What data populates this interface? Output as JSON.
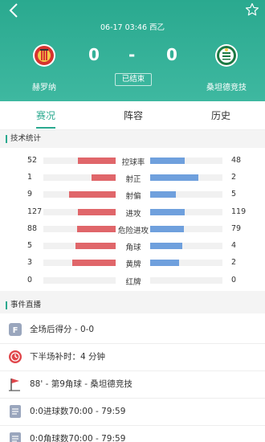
{
  "header": {
    "datetime": "06-17 03:46 西乙",
    "home_team": "赫罗纳",
    "away_team": "桑坦德竞技",
    "home_score": "0",
    "separator": "-",
    "away_score": "0",
    "status": "已结束",
    "icons": {
      "back": "chevron-left-icon",
      "favorite": "star-outline-icon"
    }
  },
  "tabs": [
    "赛况",
    "阵容",
    "历史"
  ],
  "active_tab": "赛况",
  "stats_section": {
    "title": "技术统计",
    "rows": [
      {
        "label": "控球率",
        "home": "52",
        "away": "48",
        "home_fill": 0.52,
        "away_fill": 0.48
      },
      {
        "label": "射正",
        "home": "1",
        "away": "2",
        "home_fill": 0.33,
        "away_fill": 0.67
      },
      {
        "label": "射偏",
        "home": "9",
        "away": "5",
        "home_fill": 0.64,
        "away_fill": 0.36
      },
      {
        "label": "进攻",
        "home": "127",
        "away": "119",
        "home_fill": 0.52,
        "away_fill": 0.48
      },
      {
        "label": "危险进攻",
        "home": "88",
        "away": "79",
        "home_fill": 0.53,
        "away_fill": 0.47
      },
      {
        "label": "角球",
        "home": "5",
        "away": "4",
        "home_fill": 0.56,
        "away_fill": 0.44
      },
      {
        "label": "黄牌",
        "home": "3",
        "away": "2",
        "home_fill": 0.6,
        "away_fill": 0.4
      },
      {
        "label": "红牌",
        "home": "0",
        "away": "0",
        "home_fill": 0,
        "away_fill": 0
      }
    ],
    "colors": {
      "home": "#e0666a",
      "away": "#6fa0dd"
    }
  },
  "events_section": {
    "title": "事件直播",
    "events": [
      {
        "icon": "final-score-icon",
        "text": "全场后得分 - 0-0"
      },
      {
        "icon": "whistle-clock-icon",
        "text": "下半场补时：4 分钟"
      },
      {
        "icon": "corner-flag-icon",
        "text": "88' - 第9角球 - 桑坦德竞技"
      },
      {
        "icon": "document-icon",
        "text": "0:0进球数70:00 - 79:59"
      },
      {
        "icon": "document-icon",
        "text": "0:0角球数70:00 - 79:59"
      }
    ]
  },
  "accent_color": "#2aa98f"
}
